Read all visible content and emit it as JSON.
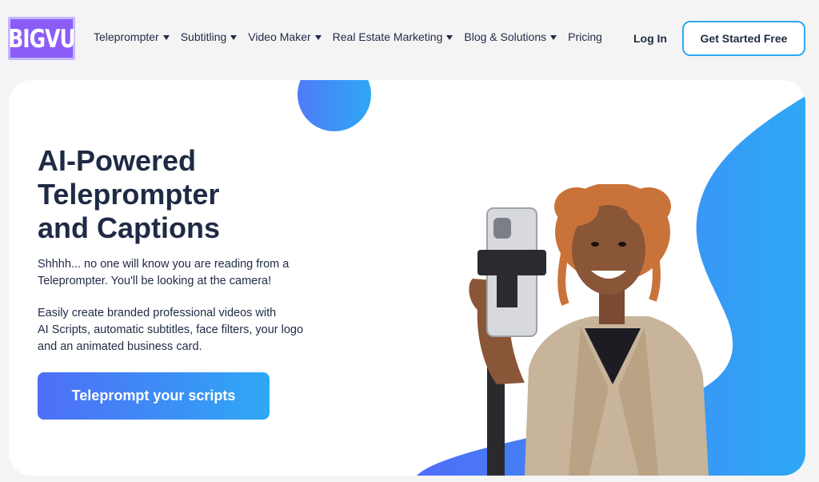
{
  "brand": {
    "logo_text": "BIGVU",
    "logo_color": "#8b5cf6"
  },
  "nav": {
    "items": [
      {
        "label": "Teleprompter",
        "has_dropdown": true
      },
      {
        "label": "Subtitling",
        "has_dropdown": true
      },
      {
        "label": "Video Maker",
        "has_dropdown": true
      },
      {
        "label": "Real Estate Marketing",
        "has_dropdown": true
      },
      {
        "label": "Blog & Solutions",
        "has_dropdown": true
      },
      {
        "label": "Pricing",
        "has_dropdown": false
      }
    ],
    "login_label": "Log In",
    "cta_label": "Get Started Free"
  },
  "hero": {
    "headline_line1": "AI-Powered",
    "headline_line2": "Teleprompter",
    "headline_line3": "and Captions",
    "para1_line1": "Shhhh... no one will know you are reading from a",
    "para1_line2": "Teleprompter. You'll be looking at the camera!",
    "para2_line1": "Easily create branded professional videos with",
    "para2_line2": "AI Scripts, automatic subtitles, face filters, your logo",
    "para2_line3": "and an animated business card.",
    "cta_label": "Teleprompt your scripts"
  },
  "colors": {
    "accent_blue": "#2ea8f5",
    "accent_indigo": "#4f6ef7",
    "text_dark": "#1f2a44"
  }
}
